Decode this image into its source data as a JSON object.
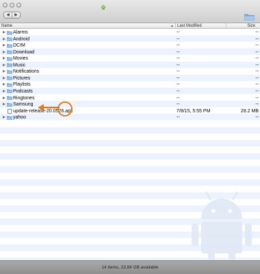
{
  "window": {
    "icons": {
      "app": "android-transfer-icon",
      "new_folder": "new-folder-icon"
    },
    "nav": {
      "back": "◀",
      "forward": "▶"
    }
  },
  "columns": {
    "name": "Name",
    "last_modified": "Last Modified",
    "size": "Size"
  },
  "files": [
    {
      "name": "Alarms",
      "type": "folder",
      "modified": "--",
      "size": "--"
    },
    {
      "name": "Android",
      "type": "folder",
      "modified": "--",
      "size": "--"
    },
    {
      "name": "DCIM",
      "type": "folder",
      "modified": "--",
      "size": "--"
    },
    {
      "name": "Download",
      "type": "folder",
      "modified": "--",
      "size": "--"
    },
    {
      "name": "Movies",
      "type": "folder",
      "modified": "--",
      "size": "--"
    },
    {
      "name": "Music",
      "type": "folder",
      "modified": "--",
      "size": "--"
    },
    {
      "name": "Notifications",
      "type": "folder",
      "modified": "--",
      "size": "--"
    },
    {
      "name": "Pictures",
      "type": "folder",
      "modified": "--",
      "size": "--"
    },
    {
      "name": "Playlists",
      "type": "folder",
      "modified": "--",
      "size": "--"
    },
    {
      "name": "Podcasts",
      "type": "folder",
      "modified": "--",
      "size": "--"
    },
    {
      "name": "Ringtones",
      "type": "folder",
      "modified": "--",
      "size": "--"
    },
    {
      "name": "Samsung",
      "type": "folder",
      "modified": "--",
      "size": "--"
    },
    {
      "name": "update-release-20.0526.apk",
      "type": "file",
      "modified": "7/8/15, 5:55 PM",
      "size": "28.2 MB"
    },
    {
      "name": "yahoo",
      "type": "folder",
      "modified": "--",
      "size": "--"
    }
  ],
  "status": {
    "text": "14 items, 23.84 GB available"
  },
  "colors": {
    "annotation": "#e07d1b",
    "folder": "#7aaee0",
    "stripe": "#edf3fe"
  }
}
